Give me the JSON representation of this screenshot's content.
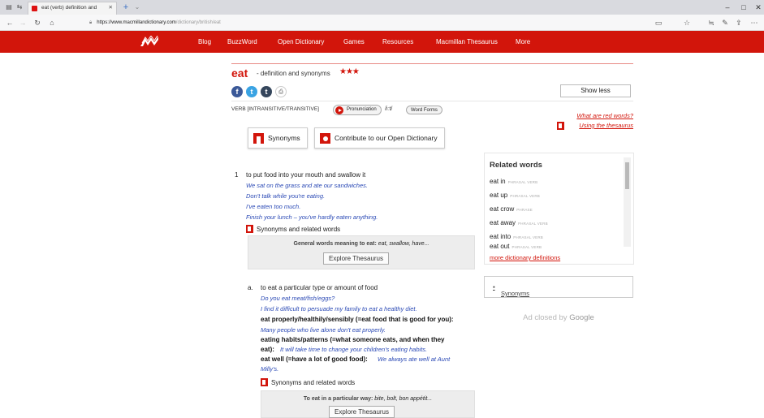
{
  "browser": {
    "tab_title": "eat (verb) definition and",
    "url_host": "https://www.macmillandictionary.com",
    "url_path": "/dictionary/british/eat"
  },
  "nav": {
    "links": [
      "Blog",
      "BuzzWord",
      "Open Dictionary",
      "Games",
      "Resources",
      "Macmillan Thesaurus",
      "More"
    ]
  },
  "entry": {
    "headword": "eat",
    "subtitle": "- definition and synonyms",
    "stars": "★★★",
    "show_less": "Show less",
    "part_of_speech": "VERB  [INTRANSITIVE/TRANSITIVE]",
    "pronunciation_label": "Pronunciation",
    "ipa": "/iːt/",
    "word_forms_label": "Word Forms",
    "red_words_link": "What are red words?",
    "using_thesaurus_link": "Using the thesaurus",
    "synonyms_button": "Synonyms",
    "contribute_button": "Contribute to our Open Dictionary"
  },
  "sense1": {
    "number": "1",
    "definition": "to put food into your mouth and swallow it",
    "examples": [
      "We sat on the grass and ate our sandwiches.",
      "Don't talk while you're eating.",
      "I've eaten too much.",
      "Finish your lunch – you've hardly eaten anything."
    ],
    "syn_related": "Synonyms and related words",
    "thes_label": "General words meaning to eat:",
    "thes_words": "eat, swallow, have...",
    "explore": "Explore Thesaurus"
  },
  "sense1a": {
    "letter": "a.",
    "definition": "to eat a particular type or amount of food",
    "ex1": "Do you eat meat/fish/eggs?",
    "ex2": "I find it difficult to persuade my family to eat a healthy diet.",
    "phrase1": "eat properly/healthily/sensibly (=eat food that is good for you):",
    "ex3": "Many people who live alone don't eat properly.",
    "phrase2": "eating habits/patterns (=what someone eats, and when they",
    "phrase2b": "eat):",
    "ex4": "It will take time to change your children's eating habits.",
    "phrase3": "eat well (=have a lot of good food):",
    "ex5": "We always ate well at Aunt",
    "ex5b": "Milly's.",
    "syn_related": "Synonyms and related words",
    "thes_label": "To eat in a particular way:",
    "thes_words": "bite, bolt, bon appétit...",
    "explore": "Explore Thesaurus"
  },
  "related": {
    "heading": "Related words",
    "items": [
      {
        "word": "eat in",
        "tag": "phrasal verb"
      },
      {
        "word": "eat up",
        "tag": "phrasal verb"
      },
      {
        "word": "eat crow",
        "tag": "phrase"
      },
      {
        "word": "eat away",
        "tag": "phrasal verb"
      },
      {
        "word": "eat into",
        "tag": "phrasal verb"
      },
      {
        "word": "eat out",
        "tag": "phrasal verb"
      }
    ],
    "more": "more dictionary definitions"
  },
  "sidebar": {
    "synonyms_toggle": "Synonyms",
    "ad_text": "Ad closed by",
    "ad_brand": "Google"
  },
  "colors": {
    "brand_red": "#d2150b",
    "example_blue": "#2a49b5"
  }
}
